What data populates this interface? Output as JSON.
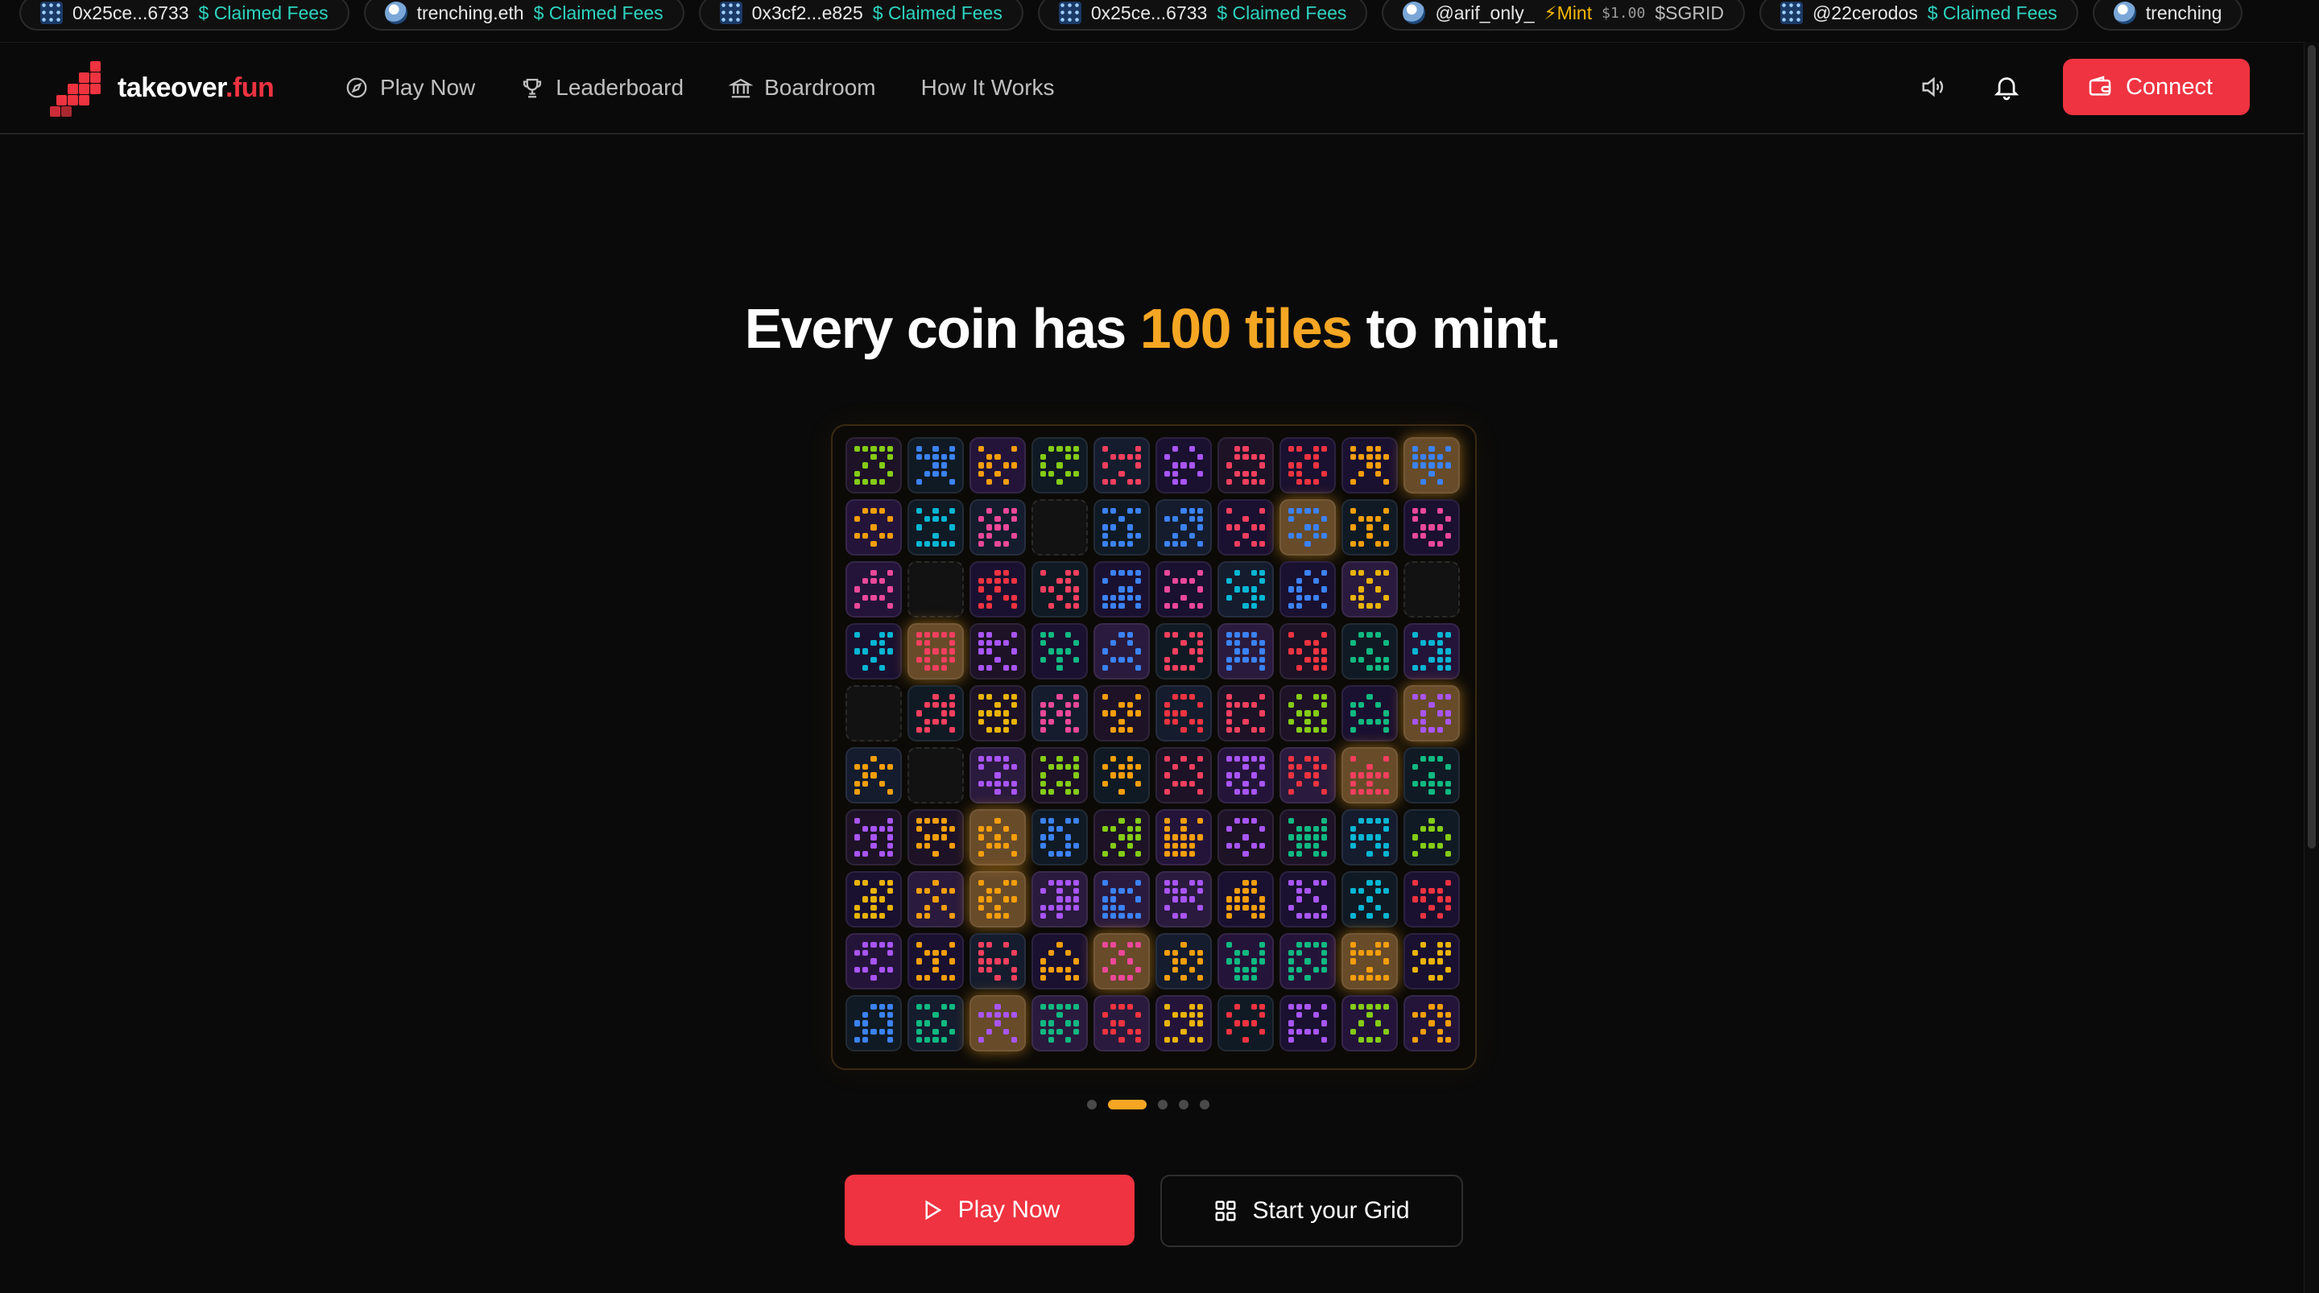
{
  "ticker": [
    {
      "user": "0x25ce...6733",
      "action": "$ Claimed Fees",
      "kind": "fees",
      "avatar": "grid"
    },
    {
      "user": "trenching.eth",
      "action": "$ Claimed Fees",
      "kind": "fees",
      "avatar": "globe"
    },
    {
      "user": "0x3cf2...e825",
      "action": "$ Claimed Fees",
      "kind": "fees",
      "avatar": "grid"
    },
    {
      "user": "0x25ce...6733",
      "action": "$ Claimed Fees",
      "kind": "fees",
      "avatar": "grid"
    },
    {
      "user": "@arif_only_",
      "action": "⚡Mint",
      "kind": "mint",
      "price": "$1.00",
      "token": "$SGRID",
      "avatar": "globe"
    },
    {
      "user": "@22cerodos",
      "action": "$ Claimed Fees",
      "kind": "fees",
      "avatar": "grid"
    },
    {
      "user": "trenching",
      "action": "",
      "kind": "fees",
      "avatar": "globe"
    }
  ],
  "nav": {
    "brand_main": "takeover",
    "brand_accent": ".fun",
    "links": [
      {
        "label": "Play Now",
        "icon": "compass-icon"
      },
      {
        "label": "Leaderboard",
        "icon": "trophy-icon"
      },
      {
        "label": "Boardroom",
        "icon": "bank-icon"
      },
      {
        "label": "How It Works",
        "icon": ""
      }
    ],
    "connect_label": "Connect"
  },
  "hero": {
    "headline_pre": "Every coin has ",
    "headline_highlight": "100 tiles",
    "headline_post": " to mint.",
    "carousel_pages": 5,
    "carousel_active": 1,
    "play_label": "Play Now",
    "grid_label": "Start your Grid"
  },
  "colors": {
    "accent_red": "#ef3340",
    "accent_orange": "#f5a623",
    "fees_teal": "#2dd4bf",
    "palette": [
      "#ef3340",
      "#f59e0b",
      "#3b82f6",
      "#ec4899",
      "#84cc16",
      "#a855f7",
      "#06b6d4",
      "#10b981",
      "#f43f5e",
      "#eab308"
    ]
  }
}
